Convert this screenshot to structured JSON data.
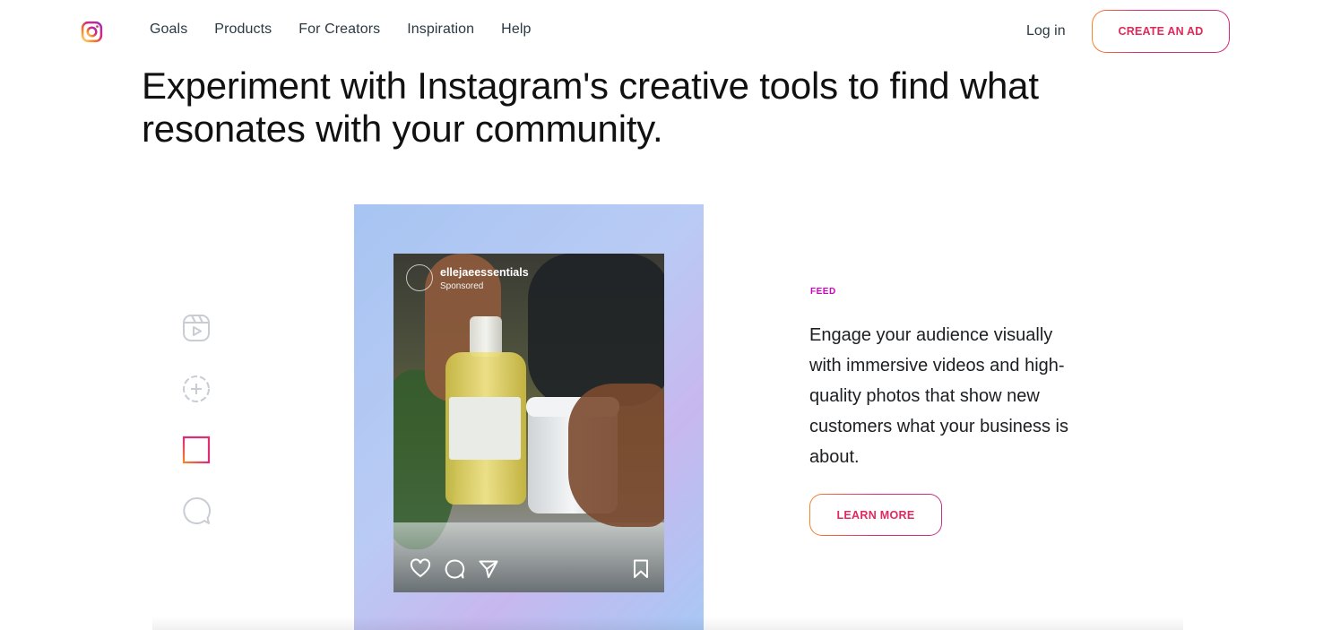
{
  "nav": {
    "logo_icon": "instagram-logo-icon",
    "links": [
      "Goals",
      "Products",
      "For Creators",
      "Inspiration",
      "Help"
    ],
    "login_label": "Log in",
    "cta_label": "CREATE AN AD"
  },
  "hero": {
    "headline": "Experiment with Instagram's creative tools to find what resonates with your community."
  },
  "side_nav": {
    "icons": [
      "reels-icon",
      "stories-icon",
      "feed-grid-icon",
      "messages-icon"
    ],
    "active_icon": "feed-grid-icon"
  },
  "feature": {
    "post": {
      "username": "ellejaeessentials",
      "sponsored_label": "Sponsored",
      "action_icons": [
        "heart-icon",
        "comment-icon",
        "share-icon",
        "bookmark-icon"
      ]
    },
    "eyebrow": "FEED",
    "description": "Engage your audience visually with immersive videos and high-quality photos that show new customers what your business is about.",
    "button_label": "LEARN MORE"
  },
  "colors": {
    "accent_pink": "#dd2a7b",
    "accent_orange": "#f58529",
    "eyebrow_magenta": "#d300c5"
  }
}
